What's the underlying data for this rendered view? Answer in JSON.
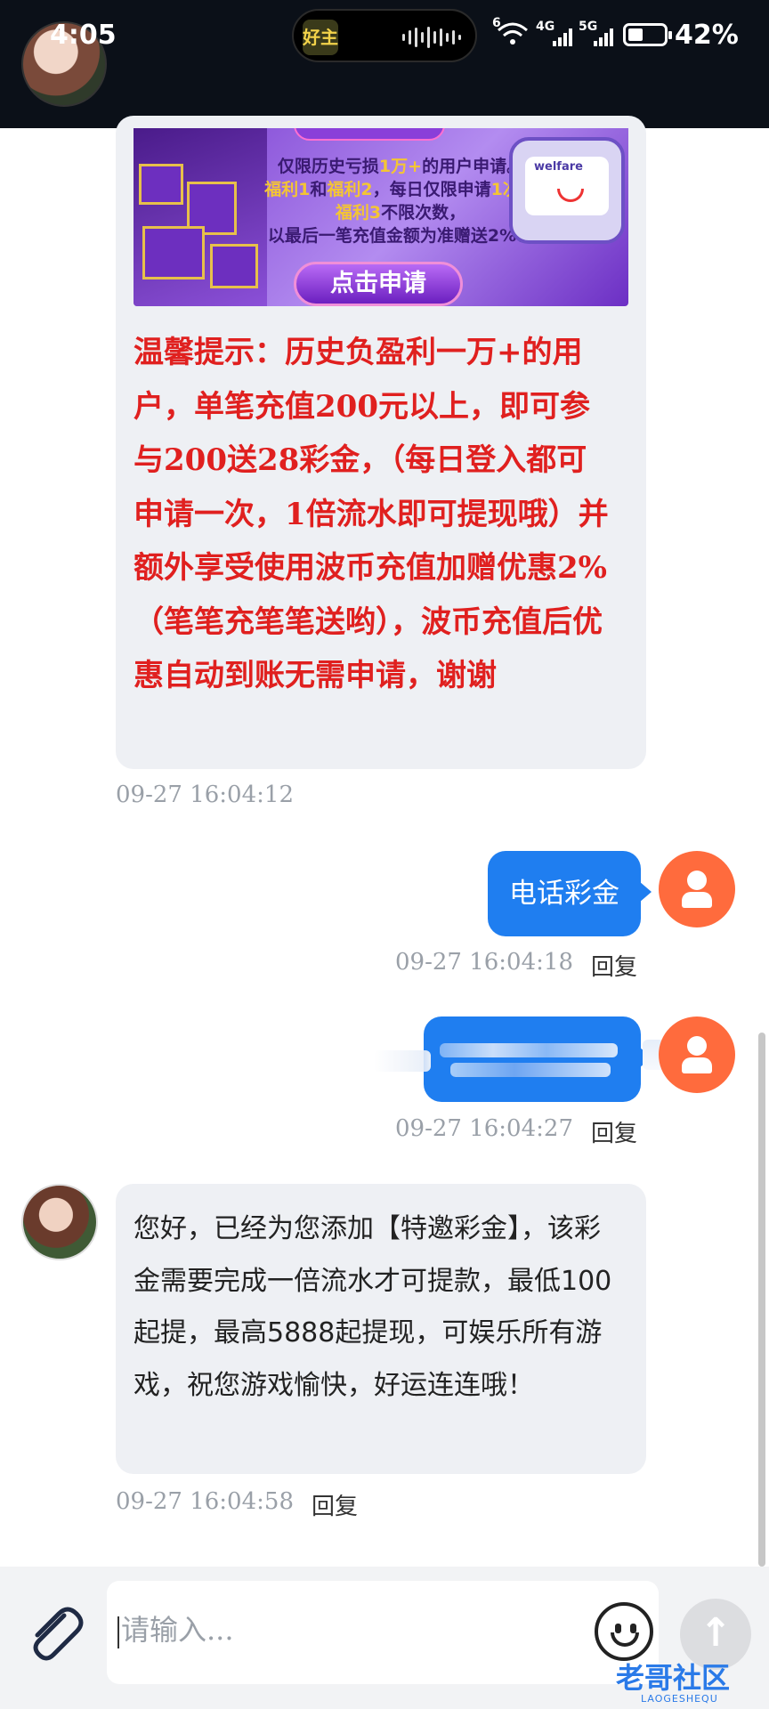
{
  "status_bar": {
    "time": "4:05",
    "island_app_label": "好主",
    "signal_wifi": "6",
    "signal_4g": "4G",
    "signal_5g": "5G",
    "battery_percent": "42%",
    "battery_level": 0.42
  },
  "messages": [
    {
      "from": "agent",
      "banner": {
        "line1_a": "仅限历史亏损",
        "line1_b": "1万+",
        "line1_c": "的用户申请。",
        "line2_a": "福利1",
        "line2_b": "和",
        "line2_c": "福利2",
        "line2_d": "，每日仅限申请",
        "line2_e": "1次",
        "line2_f": "！",
        "line3_a": "福利3",
        "line3_b": "不限次数，",
        "line4": "以最后一笔充值金额为准赠送2%！",
        "robot_label": "welfare",
        "button": "点击申请"
      },
      "text": "温馨提示：历史负盈利一万+的用户，单笔充值200元以上，即可参与200送28彩金，（每日登入都可申请一次，1倍流水即可提现哦）并额外享受使用波币充值加赠优惠2%（笔笔充笔笔送哟），波币充值后优惠自动到账无需申请，谢谢",
      "timestamp": "09-27 16:04:12"
    },
    {
      "from": "user",
      "text": "电话彩金",
      "timestamp": "09-27 16:04:18",
      "reply": "回复"
    },
    {
      "from": "user",
      "text": "",
      "timestamp": "09-27 16:04:27",
      "reply": "回复"
    },
    {
      "from": "agent",
      "text": "您好，已经为您添加【特邀彩金】，该彩金需要完成一倍流水才可提款，最低100起提，最高5888起提现，可娱乐所有游戏，祝您游戏愉快，好运连连哦！",
      "timestamp": "09-27 16:04:58",
      "reply": "回复"
    }
  ],
  "input": {
    "placeholder": "请输入..."
  },
  "icons": {
    "attach": "paperclip-icon",
    "emoji": "emoji-icon",
    "send": "arrow-up-icon"
  },
  "watermark": {
    "main": "老哥社区",
    "sub": "LAOGESHEQU"
  },
  "colors": {
    "outgoing_bubble": "#1f7ef0",
    "incoming_bubble": "#eef0f4",
    "warning_text": "#e0201f",
    "user_avatar": "#ff6b3d"
  }
}
